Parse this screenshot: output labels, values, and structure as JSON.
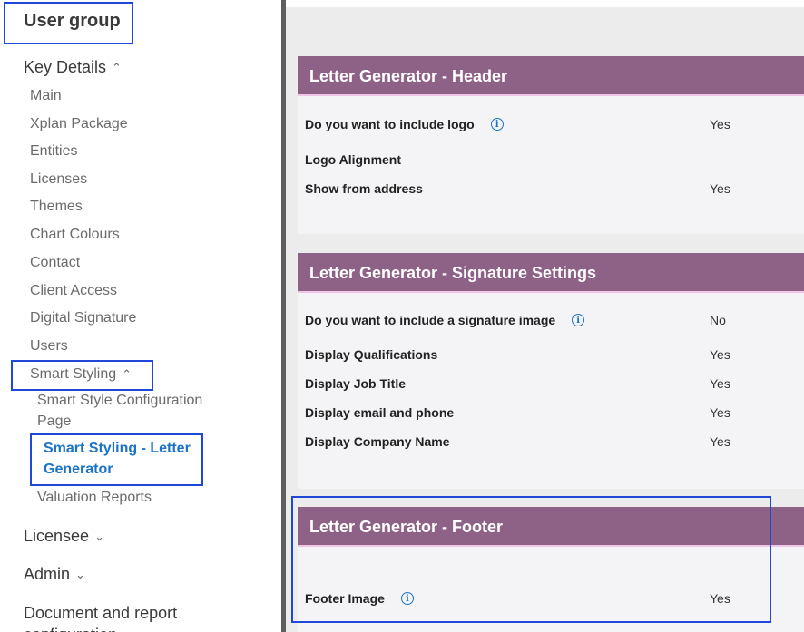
{
  "sidebar": {
    "group_title": "User group",
    "key_details": {
      "label": "Key Details",
      "chevron": "chevron-up-icon"
    },
    "key_items": [
      "Main",
      "Xplan Package",
      "Entities",
      "Licenses",
      "Themes",
      "Chart Colours",
      "Contact",
      "Client Access",
      "Digital Signature",
      "Users"
    ],
    "smart_styling": {
      "label": "Smart Styling",
      "chevron": "chevron-up-icon",
      "sub_items": [
        "Smart Style Configuration Page",
        "Smart Styling - Letter Generator",
        "Valuation Reports"
      ]
    },
    "licensee": "Licensee",
    "admin": "Admin",
    "doc_config": "Document and report configuration"
  },
  "cards": {
    "header": {
      "title": "Letter Generator - Header",
      "rows": [
        {
          "label": "Do you want to include logo",
          "value": "Yes",
          "info": true
        },
        {
          "label": "Logo Alignment",
          "value": ""
        },
        {
          "label": "Show from address",
          "value": "Yes"
        }
      ]
    },
    "signature": {
      "title": "Letter Generator - Signature Settings",
      "rows": [
        {
          "label": "Do you want to include a signature image",
          "value": "No",
          "info": true
        },
        {
          "label": "Display Qualifications",
          "value": "Yes"
        },
        {
          "label": "Display Job Title",
          "value": "Yes"
        },
        {
          "label": "Display email and phone",
          "value": "Yes"
        },
        {
          "label": "Display Company Name",
          "value": "Yes"
        }
      ]
    },
    "footer": {
      "title": "Letter Generator - Footer",
      "rows": [
        {
          "label": "Footer Image",
          "value": "Yes",
          "info": true
        }
      ]
    }
  },
  "colors": {
    "card_header": "#8e6286",
    "highlight_box": "#1f47d8",
    "active_link": "#1a73c7"
  }
}
